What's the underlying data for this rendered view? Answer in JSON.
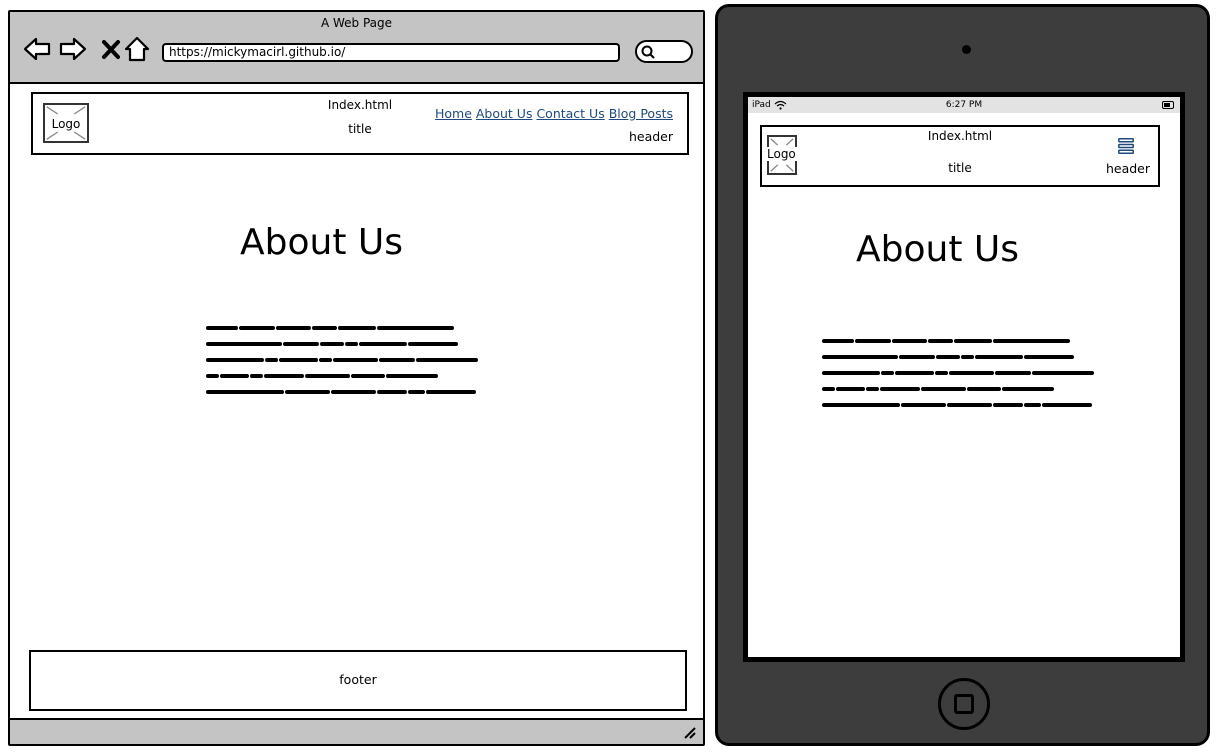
{
  "browser": {
    "window_title": "A Web Page",
    "url": "https://mickymacirl.github.io/"
  },
  "desktop": {
    "header": {
      "logo": "Logo",
      "file_name": "Index.html",
      "title": "title",
      "label": "header",
      "nav": [
        {
          "label": "Home"
        },
        {
          "label": "About Us"
        },
        {
          "label": "Contact Us"
        },
        {
          "label": "Blog Posts"
        }
      ]
    },
    "heading": "About Us",
    "footer": "footer"
  },
  "tablet": {
    "status": {
      "carrier": "iPad",
      "time": "6:27 PM"
    },
    "header": {
      "logo": "Logo",
      "file_name": "Index.html",
      "title": "title",
      "label": "header"
    },
    "heading": "About Us"
  },
  "icons": {
    "back": "arrow-left-icon",
    "forward": "arrow-right-icon",
    "stop": "close-icon",
    "home": "home-icon",
    "search": "search-icon",
    "menu": "hamburger-menu-icon",
    "wifi": "wifi-icon",
    "battery": "battery-icon",
    "resize": "resize-grip-icon"
  },
  "colors": {
    "chrome": "#c4c4c4",
    "link": "#1e4a7d",
    "device": "#3d3d3d",
    "status_bar": "#e3e3e3"
  }
}
